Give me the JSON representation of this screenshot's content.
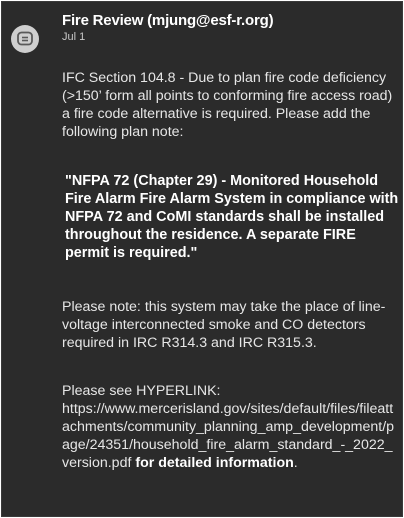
{
  "comment": {
    "author": "Fire Review (mjung@esf-r.org)",
    "date": "Jul 1",
    "intro": "IFC Section 104.8 - Due to plan fire code deficiency (>150’ form all points to conforming fire access road) a fire code alternative is required. Please add the following plan note:",
    "quote": "\"NFPA 72 (Chapter 29) - Monitored Household Fire Alarm Fire Alarm System in compliance with NFPA 72 and CoMI standards shall be installed throughout the residence.  A separate FIRE permit is required.\"",
    "note": "Please note: this system may take the place of line-voltage interconnected smoke and CO detectors required in IRC R314.3 and IRC R315.3.",
    "link_prefix": "Please see HYPERLINK:",
    "link_url": "https://www.mercerisland.gov/sites/default/files/fileattachments/community_planning_amp_development/page/24351/household_fire_alarm_standard_-_2022_version.pdf",
    "link_suffix": " for detailed information",
    "link_end": "."
  },
  "icons": {
    "avatar": "comment-bubble-icon"
  }
}
